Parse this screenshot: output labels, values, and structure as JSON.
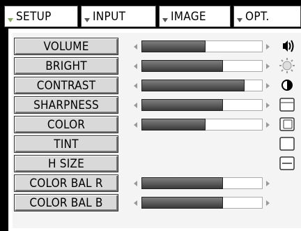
{
  "tabs": [
    {
      "label": "SETUP",
      "active": true
    },
    {
      "label": "INPUT",
      "active": false
    },
    {
      "label": "IMAGE",
      "active": false
    },
    {
      "label": "OPT.",
      "active": false
    }
  ],
  "items": [
    {
      "label": "VOLUME",
      "level": 0.53,
      "icon": "speaker-icon"
    },
    {
      "label": "BRIGHT",
      "level": 0.67,
      "icon": "sun-icon"
    },
    {
      "label": "CONTRAST",
      "level": 0.85,
      "icon": "contrast-icon"
    },
    {
      "label": "SHARPNESS",
      "level": 0.67,
      "icon": "sharpness-icon"
    },
    {
      "label": "COLOR",
      "level": 0.53,
      "icon": "color-icon"
    },
    {
      "label": "TINT",
      "level": null,
      "icon": "tint-icon"
    },
    {
      "label": "H SIZE",
      "level": null,
      "icon": "hsize-icon"
    },
    {
      "label": "COLOR BAL R",
      "level": 0.67,
      "icon": null
    },
    {
      "label": "COLOR BAL B",
      "level": 0.67,
      "icon": null
    }
  ],
  "colors": {
    "background": "#000000",
    "panel": "#ffffff",
    "button": "#d9d9d9",
    "fill": "#5a5a5a"
  }
}
